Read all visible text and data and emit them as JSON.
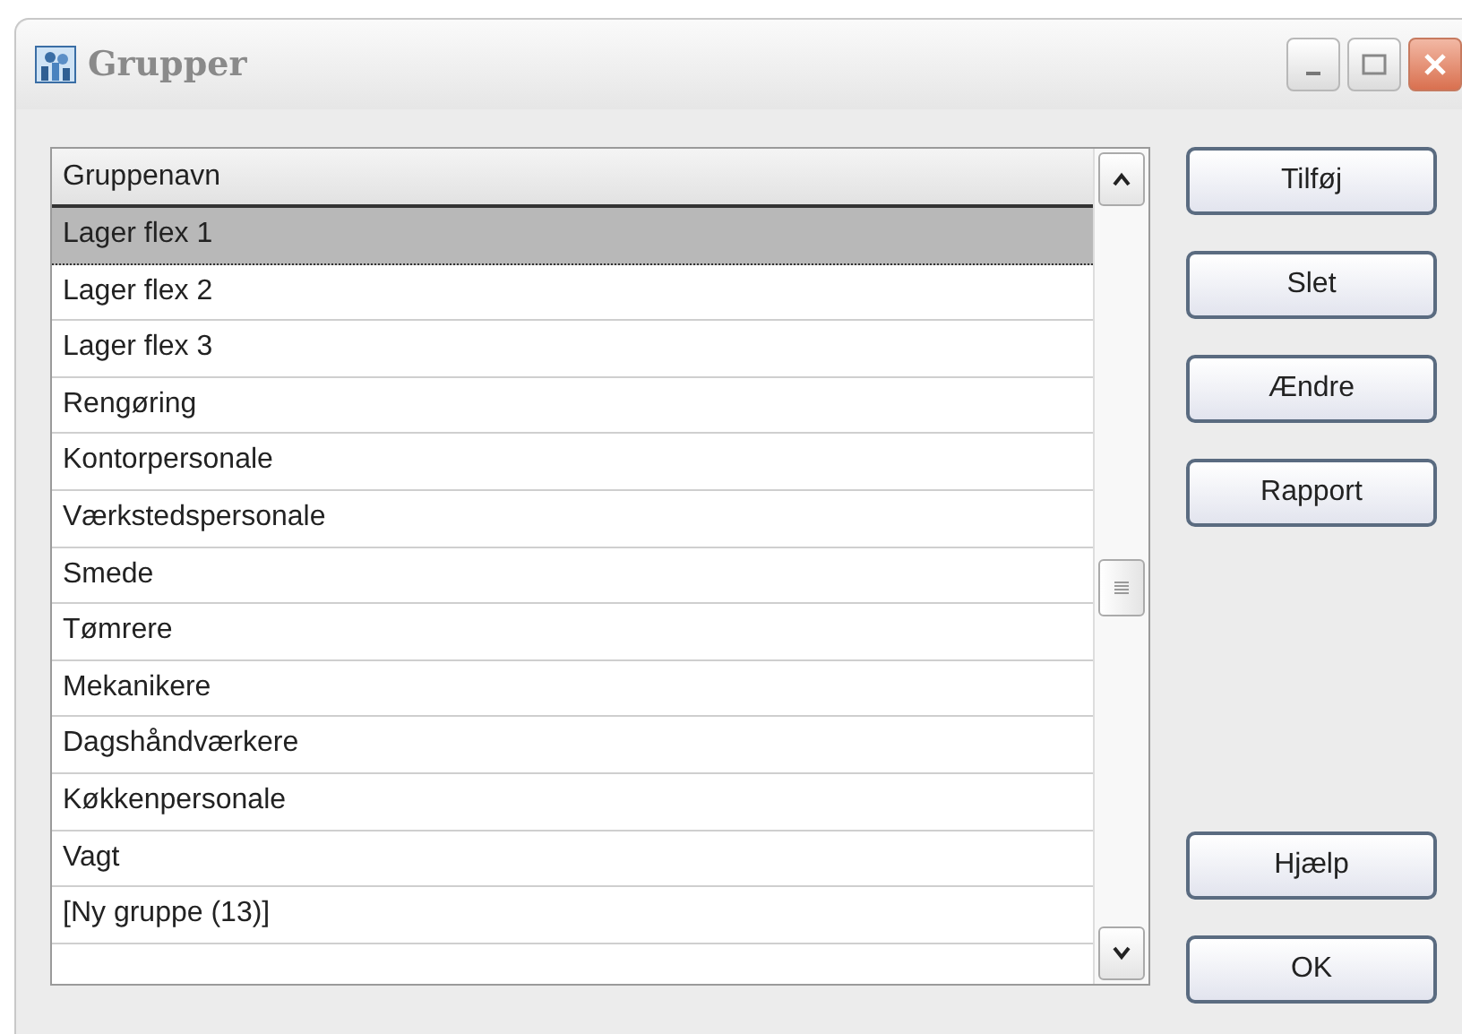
{
  "window": {
    "title": "Grupper"
  },
  "list": {
    "column": "Gruppenavn",
    "rows": [
      {
        "name": "Lager flex 1",
        "selected": true
      },
      {
        "name": "Lager flex 2",
        "selected": false
      },
      {
        "name": "Lager flex 3",
        "selected": false
      },
      {
        "name": "Rengøring",
        "selected": false
      },
      {
        "name": "Kontorpersonale",
        "selected": false
      },
      {
        "name": "Værkstedspersonale",
        "selected": false
      },
      {
        "name": "Smede",
        "selected": false
      },
      {
        "name": "Tømrere",
        "selected": false
      },
      {
        "name": "Mekanikere",
        "selected": false
      },
      {
        "name": "Dagshåndværkere",
        "selected": false
      },
      {
        "name": "Køkkenpersonale",
        "selected": false
      },
      {
        "name": "Vagt",
        "selected": false
      },
      {
        "name": "[Ny gruppe (13)]",
        "selected": false
      }
    ]
  },
  "buttons_top": [
    "Tilføj",
    "Slet",
    "Ændre",
    "Rapport"
  ],
  "buttons_bottom": [
    "Hjælp",
    "OK"
  ]
}
